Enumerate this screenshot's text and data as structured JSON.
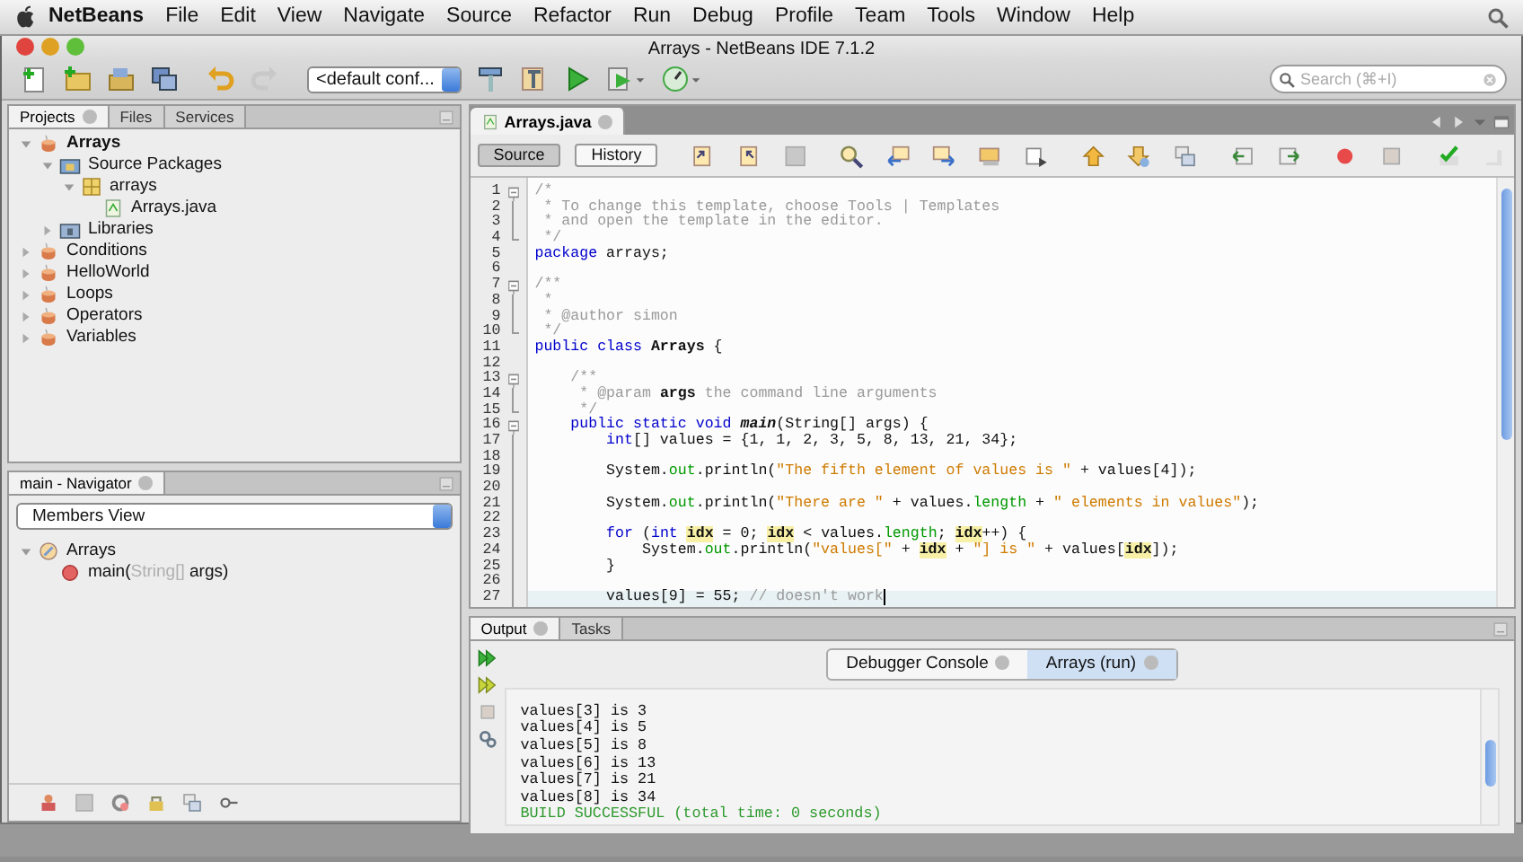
{
  "menu_bar": {
    "app": "NetBeans",
    "items": [
      "File",
      "Edit",
      "View",
      "Navigate",
      "Source",
      "Refactor",
      "Run",
      "Debug",
      "Profile",
      "Team",
      "Tools",
      "Window",
      "Help"
    ]
  },
  "window": {
    "title": "Arrays - NetBeans IDE 7.1.2"
  },
  "toolbar": {
    "configuration": "<default conf...",
    "search": {
      "placeholder": "Search (⌘+I)"
    }
  },
  "projects_panel": {
    "tabs": [
      {
        "label": "Projects",
        "selected": true,
        "closable": true
      },
      {
        "label": "Files",
        "selected": false,
        "closable": false
      },
      {
        "label": "Services",
        "selected": false,
        "closable": false
      }
    ],
    "tree": [
      {
        "label": "Arrays",
        "kind": "project",
        "main_project": true,
        "expanded": true,
        "children": [
          {
            "label": "Source Packages",
            "kind": "source-folder",
            "expanded": true,
            "children": [
              {
                "label": "arrays",
                "kind": "package",
                "expanded": true,
                "children": [
                  {
                    "label": "Arrays.java",
                    "kind": "java-file"
                  }
                ]
              }
            ]
          },
          {
            "label": "Libraries",
            "kind": "library",
            "expanded": false
          }
        ]
      },
      {
        "label": "Conditions",
        "kind": "project",
        "main_project": false,
        "expanded": false
      },
      {
        "label": "HelloWorld",
        "kind": "project",
        "main_project": false,
        "expanded": false
      },
      {
        "label": "Loops",
        "kind": "project",
        "main_project": false,
        "expanded": false
      },
      {
        "label": "Operators",
        "kind": "project",
        "main_project": false,
        "expanded": false
      },
      {
        "label": "Variables",
        "kind": "project",
        "main_project": false,
        "expanded": false
      }
    ]
  },
  "navigator": {
    "tabs": [
      {
        "label": "main - Navigator",
        "selected": true,
        "closable": true
      }
    ],
    "view": "Members View",
    "tree": [
      {
        "kind": "class",
        "expanded": true,
        "parts": [
          {
            "kind": "plain",
            "text": "Arrays"
          }
        ],
        "children": [
          {
            "kind": "method",
            "parts": [
              {
                "kind": "plain",
                "text": "main("
              },
              {
                "kind": "type",
                "text": "String[]"
              },
              {
                "kind": "plain",
                "text": " args)"
              }
            ]
          }
        ]
      }
    ]
  },
  "editor": {
    "tabs": [
      {
        "label": "Arrays.java",
        "selected": true
      }
    ],
    "views": [
      {
        "label": "Source",
        "selected": true
      },
      {
        "label": "History",
        "selected": false
      }
    ],
    "lines": [
      {
        "num": "1",
        "folded": false,
        "tokens": [
          {
            "kind": "comment",
            "text": "/*"
          }
        ]
      },
      {
        "num": "2",
        "tokens": [
          {
            "kind": "comment",
            "text": " * To change this template, choose Tools | Templates"
          }
        ]
      },
      {
        "num": "3",
        "tokens": [
          {
            "kind": "comment",
            "text": " * and open the template in the editor."
          }
        ]
      },
      {
        "num": "4",
        "fold_end": true,
        "tokens": [
          {
            "kind": "comment",
            "text": " */"
          }
        ]
      },
      {
        "num": "5",
        "tokens": [
          {
            "kind": "keyword",
            "text": "package"
          },
          {
            "kind": "plain",
            "text": " arrays;"
          }
        ]
      },
      {
        "num": "6"
      },
      {
        "num": "7",
        "folded": false,
        "tokens": [
          {
            "kind": "comment",
            "text": "/**"
          }
        ]
      },
      {
        "num": "8",
        "tokens": [
          {
            "kind": "comment",
            "text": " *"
          }
        ]
      },
      {
        "num": "9",
        "tokens": [
          {
            "kind": "comment",
            "text": " * @author simon"
          }
        ]
      },
      {
        "num": "10",
        "fold_end": true,
        "tokens": [
          {
            "kind": "comment",
            "text": " */"
          }
        ]
      },
      {
        "num": "11",
        "tokens": [
          {
            "kind": "keyword",
            "text": "public class "
          },
          {
            "kind": "bold",
            "text": "Arrays"
          },
          {
            "kind": "plain",
            "text": " {"
          }
        ]
      },
      {
        "num": "12"
      },
      {
        "num": "13",
        "folded": false,
        "tokens": [
          {
            "kind": "comment",
            "text": "    /**"
          }
        ]
      },
      {
        "num": "14",
        "tokens": [
          {
            "kind": "comment",
            "text": "     * @param "
          },
          {
            "kind": "bold",
            "text": "args"
          },
          {
            "kind": "comment",
            "text": " the command line arguments"
          }
        ]
      },
      {
        "num": "15",
        "fold_end": true,
        "tokens": [
          {
            "kind": "comment",
            "text": "     */"
          }
        ]
      },
      {
        "num": "16",
        "folded": false,
        "tokens": [
          {
            "kind": "keyword",
            "text": "    public static void "
          },
          {
            "kind": "method",
            "text": "main"
          },
          {
            "kind": "plain",
            "text": "(String[] args) {"
          }
        ]
      },
      {
        "num": "17",
        "tokens": [
          {
            "kind": "keyword",
            "text": "        int"
          },
          {
            "kind": "plain",
            "text": "[] values = {1, 1, 2, 3, 5, 8, 13, 21, 34};"
          }
        ]
      },
      {
        "num": "18"
      },
      {
        "num": "19",
        "tokens": [
          {
            "kind": "plain",
            "text": "        System."
          },
          {
            "kind": "field",
            "text": "out"
          },
          {
            "kind": "plain",
            "text": ".println("
          },
          {
            "kind": "string",
            "text": "\"The fifth element of values is \""
          },
          {
            "kind": "plain",
            "text": " + values[4]);"
          }
        ]
      },
      {
        "num": "20"
      },
      {
        "num": "21",
        "tokens": [
          {
            "kind": "plain",
            "text": "        System."
          },
          {
            "kind": "field",
            "text": "out"
          },
          {
            "kind": "plain",
            "text": ".println("
          },
          {
            "kind": "string",
            "text": "\"There are \""
          },
          {
            "kind": "plain",
            "text": " + values."
          },
          {
            "kind": "field",
            "text": "length"
          },
          {
            "kind": "plain",
            "text": " + "
          },
          {
            "kind": "string",
            "text": "\" elements in values\""
          },
          {
            "kind": "plain",
            "text": ");"
          }
        ]
      },
      {
        "num": "22"
      },
      {
        "num": "23",
        "tokens": [
          {
            "kind": "keyword",
            "text": "        for"
          },
          {
            "kind": "plain",
            "text": " ("
          },
          {
            "kind": "keyword",
            "text": "int "
          },
          {
            "kind": "mark",
            "text": "idx"
          },
          {
            "kind": "plain",
            "text": " = 0; "
          },
          {
            "kind": "mark",
            "text": "idx"
          },
          {
            "kind": "plain",
            "text": " < values."
          },
          {
            "kind": "field",
            "text": "length"
          },
          {
            "kind": "plain",
            "text": "; "
          },
          {
            "kind": "mark",
            "text": "idx"
          },
          {
            "kind": "plain",
            "text": "++) {"
          }
        ]
      },
      {
        "num": "24",
        "tokens": [
          {
            "kind": "plain",
            "text": "            System."
          },
          {
            "kind": "field",
            "text": "out"
          },
          {
            "kind": "plain",
            "text": ".println("
          },
          {
            "kind": "string",
            "text": "\"values[\""
          },
          {
            "kind": "plain",
            "text": " + "
          },
          {
            "kind": "mark",
            "text": "idx"
          },
          {
            "kind": "plain",
            "text": " + "
          },
          {
            "kind": "string",
            "text": "\"] is \""
          },
          {
            "kind": "plain",
            "text": " + values["
          },
          {
            "kind": "mark",
            "text": "idx"
          },
          {
            "kind": "plain",
            "text": "]);"
          }
        ]
      },
      {
        "num": "25",
        "tokens": [
          {
            "kind": "plain",
            "text": "        }"
          }
        ]
      },
      {
        "num": "26"
      },
      {
        "num": "27",
        "current": true,
        "tokens": [
          {
            "kind": "plain",
            "text": "        values[9] = 55; "
          },
          {
            "kind": "comment",
            "text": "// doesn't work"
          }
        ]
      }
    ]
  },
  "output": {
    "tabs": [
      {
        "label": "Output",
        "selected": true,
        "closable": true
      },
      {
        "label": "Tasks",
        "selected": false,
        "closable": false
      }
    ],
    "consoles": [
      {
        "label": "Debugger Console",
        "selected": false
      },
      {
        "label": "Arrays (run)",
        "selected": true
      }
    ],
    "lines": [
      {
        "kind": "normal",
        "text": "values[3] is 3"
      },
      {
        "kind": "normal",
        "text": "values[4] is 5"
      },
      {
        "kind": "normal",
        "text": "values[5] is 8"
      },
      {
        "kind": "normal",
        "text": "values[6] is 13"
      },
      {
        "kind": "normal",
        "text": "values[7] is 21"
      },
      {
        "kind": "normal",
        "text": "values[8] is 34"
      },
      {
        "kind": "success",
        "text": "BUILD SUCCESSFUL (total time: 0 seconds)"
      }
    ]
  }
}
